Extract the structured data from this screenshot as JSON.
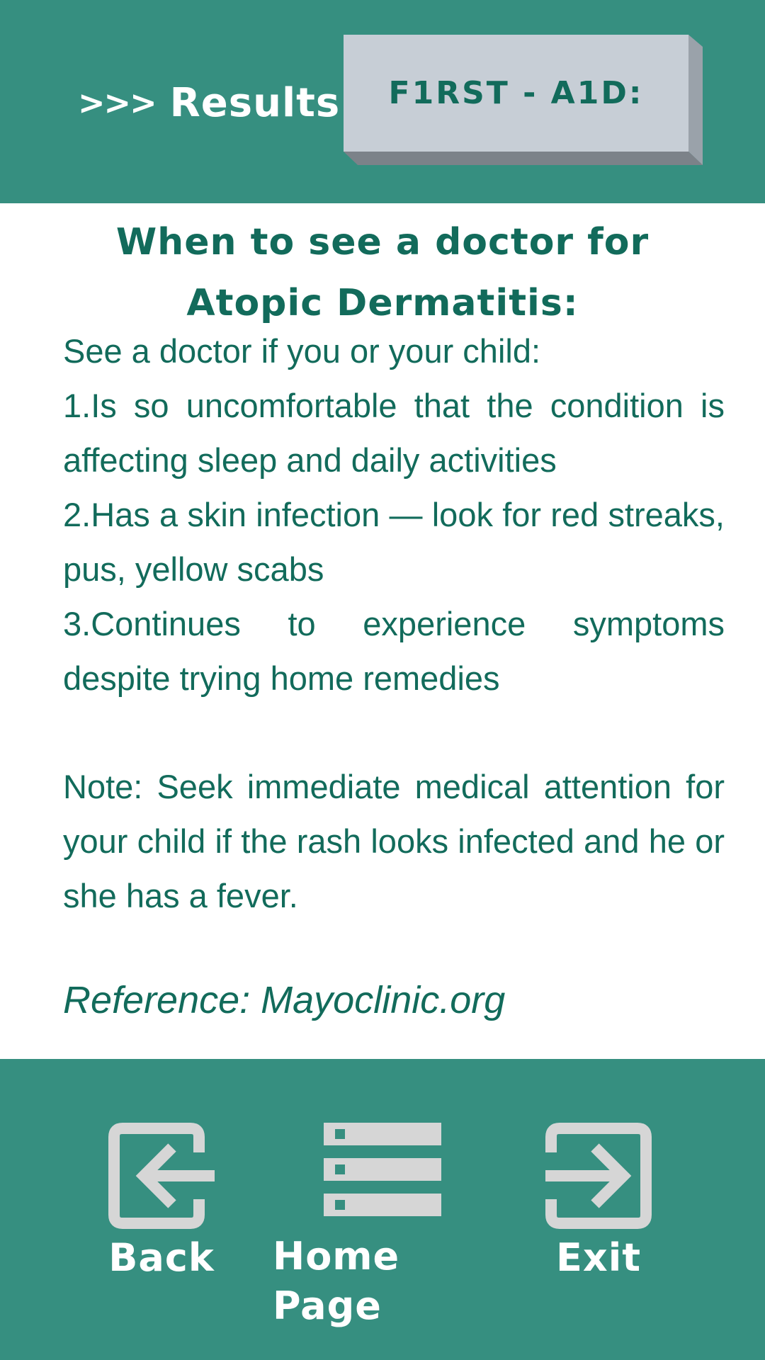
{
  "header": {
    "results_chevrons": ">>>",
    "results_label": "Results:",
    "first_aid_label": "F1RST - A1D:"
  },
  "content": {
    "title_line1": "When to see a doctor for",
    "title_line2": "Atopic Dermatitis:",
    "intro": "See a doctor if you or your child:",
    "items": [
      "1.Is so uncomfortable that the condition is affecting sleep and daily activities",
      "2.Has a skin infection — look for red streaks, pus, yellow scabs",
      "3.Continues to experience symptoms despite trying home remedies"
    ],
    "note": "Note: Seek immediate medical attention for your child if the rash looks infected and he or she has a fever.",
    "reference": "Reference: Mayoclinic.org"
  },
  "footer": {
    "back_label": "Back",
    "home_label": "Home Page",
    "exit_label": "Exit",
    "back_icon": "back-arrow-icon",
    "home_icon": "list-menu-icon",
    "exit_icon": "exit-arrow-icon"
  },
  "colors": {
    "header_bg": "#368f80",
    "text_green": "#126b5b",
    "button_face": "#c7ced6",
    "icon_gray": "#d6d6d6"
  }
}
